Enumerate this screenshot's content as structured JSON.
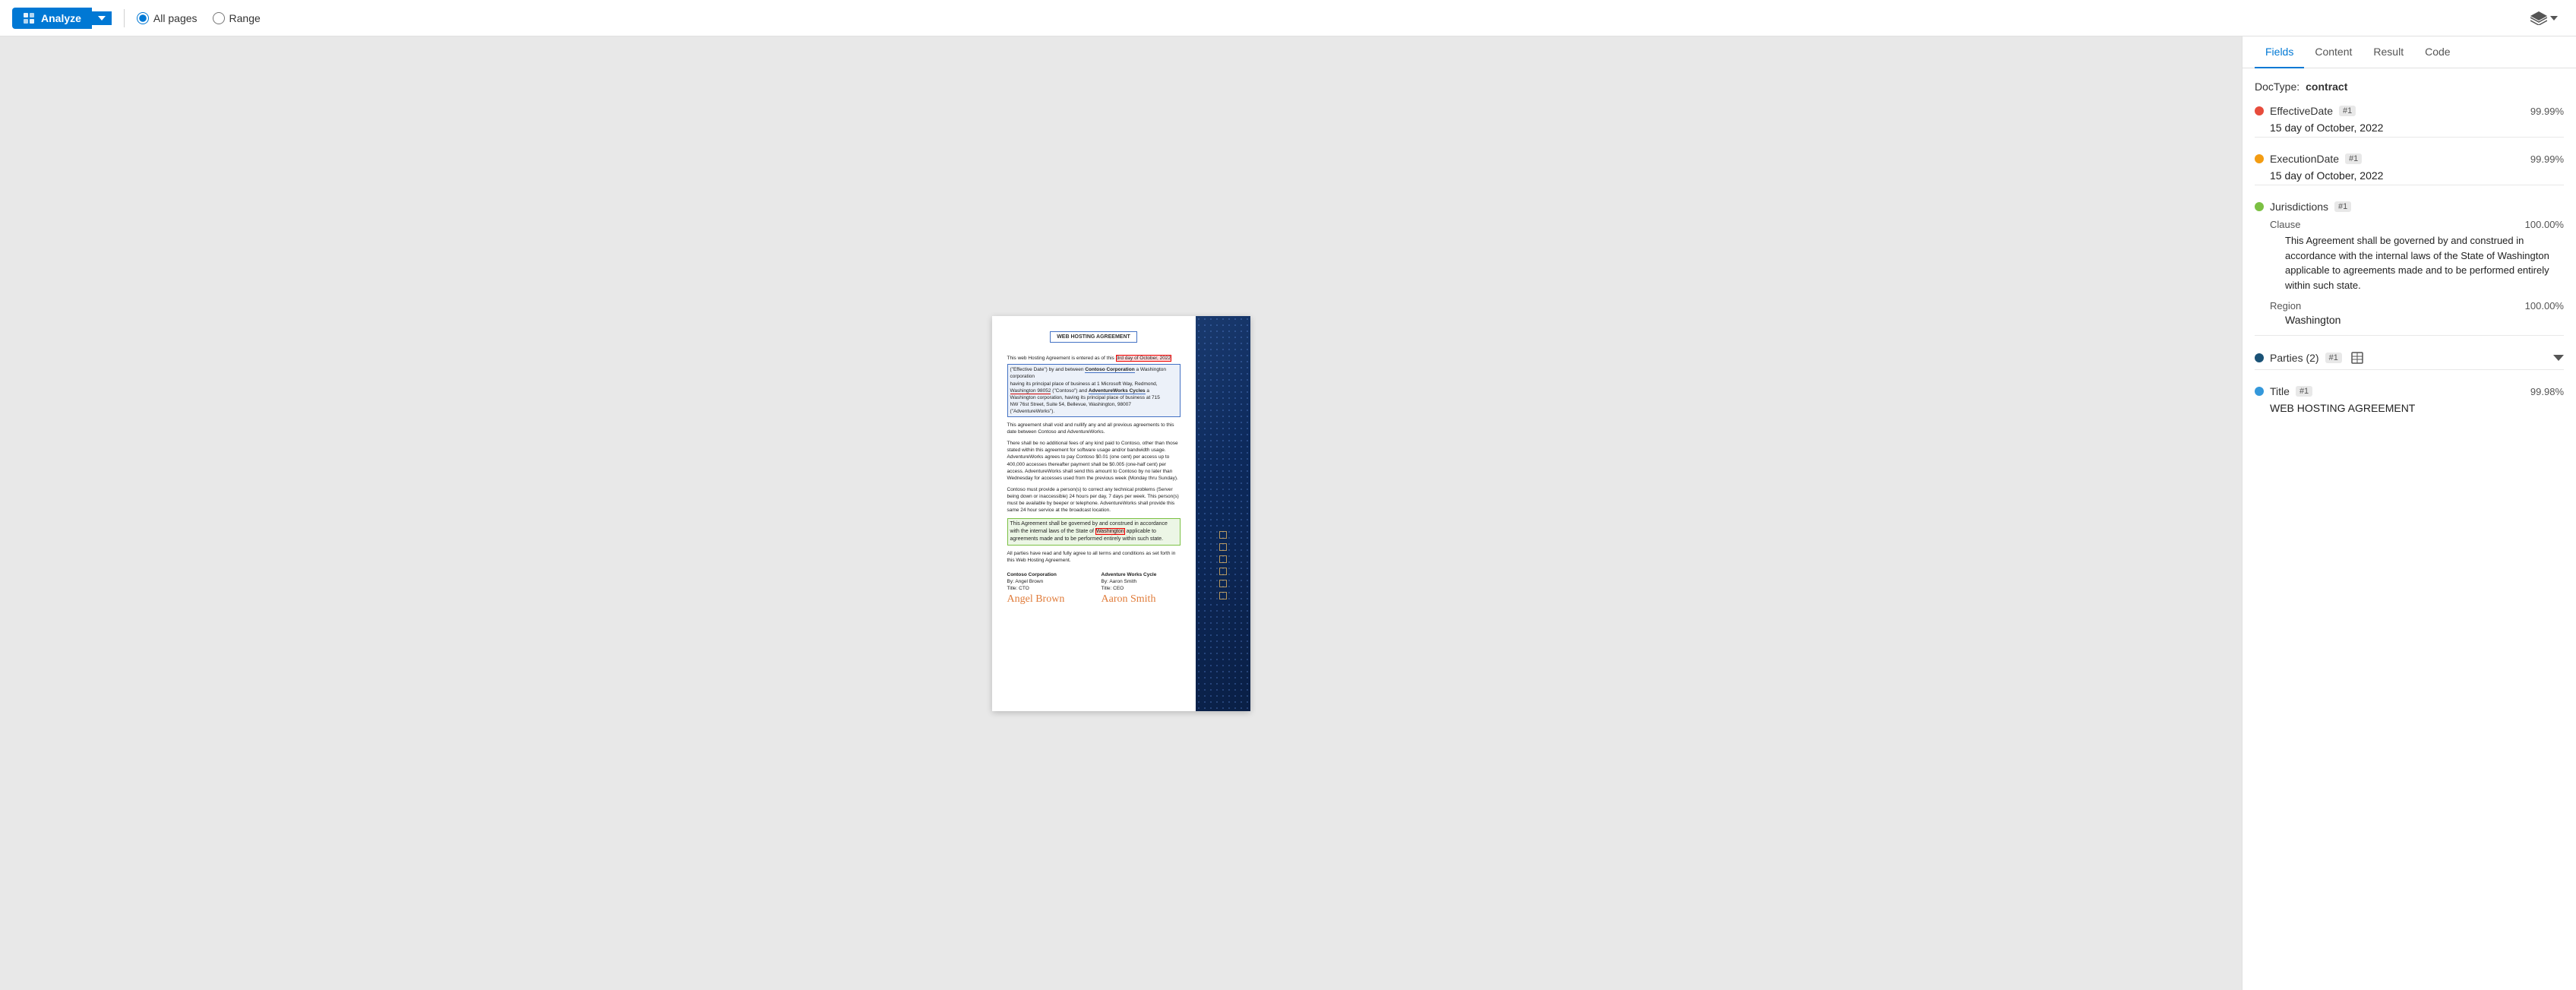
{
  "toolbar": {
    "analyze_label": "Analyze",
    "all_pages_label": "All pages",
    "range_label": "Range",
    "all_pages_checked": true
  },
  "panel": {
    "tabs": [
      "Fields",
      "Content",
      "Result",
      "Code"
    ],
    "active_tab": "Fields",
    "doctype_label": "DocType:",
    "doctype_value": "contract",
    "fields": [
      {
        "id": "effective-date",
        "name": "EffectiveDate",
        "badge": "#1",
        "dot_color": "#e74c3c",
        "confidence": "99.99%",
        "value": "15 day of October, 2022"
      },
      {
        "id": "execution-date",
        "name": "ExecutionDate",
        "badge": "#1",
        "dot_color": "#f39c12",
        "confidence": "99.99%",
        "value": "15 day of October, 2022"
      },
      {
        "id": "jurisdictions",
        "name": "Jurisdictions",
        "badge": "#1",
        "dot_color": "#7bc043",
        "confidence": "",
        "subfields": [
          {
            "name": "Clause",
            "confidence": "100.00%",
            "value": "This Agreement shall be governed by and construed in accordance with the internal laws of the State of Washington applicable to agreements made and to be performed entirely within such state."
          },
          {
            "name": "Region",
            "confidence": "100.00%",
            "value": "Washington"
          }
        ]
      },
      {
        "id": "parties",
        "name": "Parties (2)",
        "badge": "#1",
        "dot_color": "#1a5276",
        "confidence": "",
        "has_table": true,
        "collapsed": false
      },
      {
        "id": "title",
        "name": "Title",
        "badge": "#1",
        "dot_color": "#3498db",
        "confidence": "99.98%",
        "value": "WEB HOSTING AGREEMENT"
      }
    ]
  },
  "document": {
    "title": "WEB HOSTING AGREEMENT",
    "para1": "This web Hosting Agreement is entered as of this 3rd day of October, 2022 (\"Effective Date\") by and between Contoso Corporation a Washington corporation having its principal place of business at 1 Microsoft Way, Redmond, Washington 98052 (\"Contoso\") and AdventureWorks Cycles a Washington corporation, having its principal place of business at 715 NW 76st Street, Suite 54, Bellevue, Washington 98007 (\"AdventureWorks\").",
    "para2": "This agreement shall void and nullify any and all previous agreements to this date between Contoso and AdventureWorks.",
    "para3": "There shall be no additional fees of any kind paid to Contoso, other than those stated within this agreement for software usage and/or bandwidth usage. AdventureWorks agrees to pay Contoso $0.01 (one cent) per access up to 400,000 accesses thereafter payment shall be $0.005 (one-half cent) per access. AdventureWorks shall send this amount to Contoso by no later than Wednesday for accesses used from the previous week (Monday thru Sunday).",
    "para4": "Contoso must provide a person(s) to correct any technical problems (Server being down or inaccessible) 24 hours per day, 7 days per week. This person(s) must be available by beeper or telephone. AdventureWorks shall provide this same 24 hour service at the broadcast location.",
    "para5": "This Agreement shall be governed by and construed in accordance with the internal laws of the State of Washington applicable to agreements made and to be performed entirely within such state.",
    "para6": "All parties have read and fully agree to all terms and conditions as set forth in this Web Hosting Agreement.",
    "sig_left_company": "Contoso Corporation",
    "sig_left_by": "By: Angel Brown",
    "sig_left_title": "Title: CTO",
    "sig_left_name": "Angel Brown",
    "sig_right_company": "Adventure Works Cycle",
    "sig_right_by": "By: Aaron Smith",
    "sig_right_title": "Title: CEO",
    "sig_right_name": "Aaron Smith"
  }
}
